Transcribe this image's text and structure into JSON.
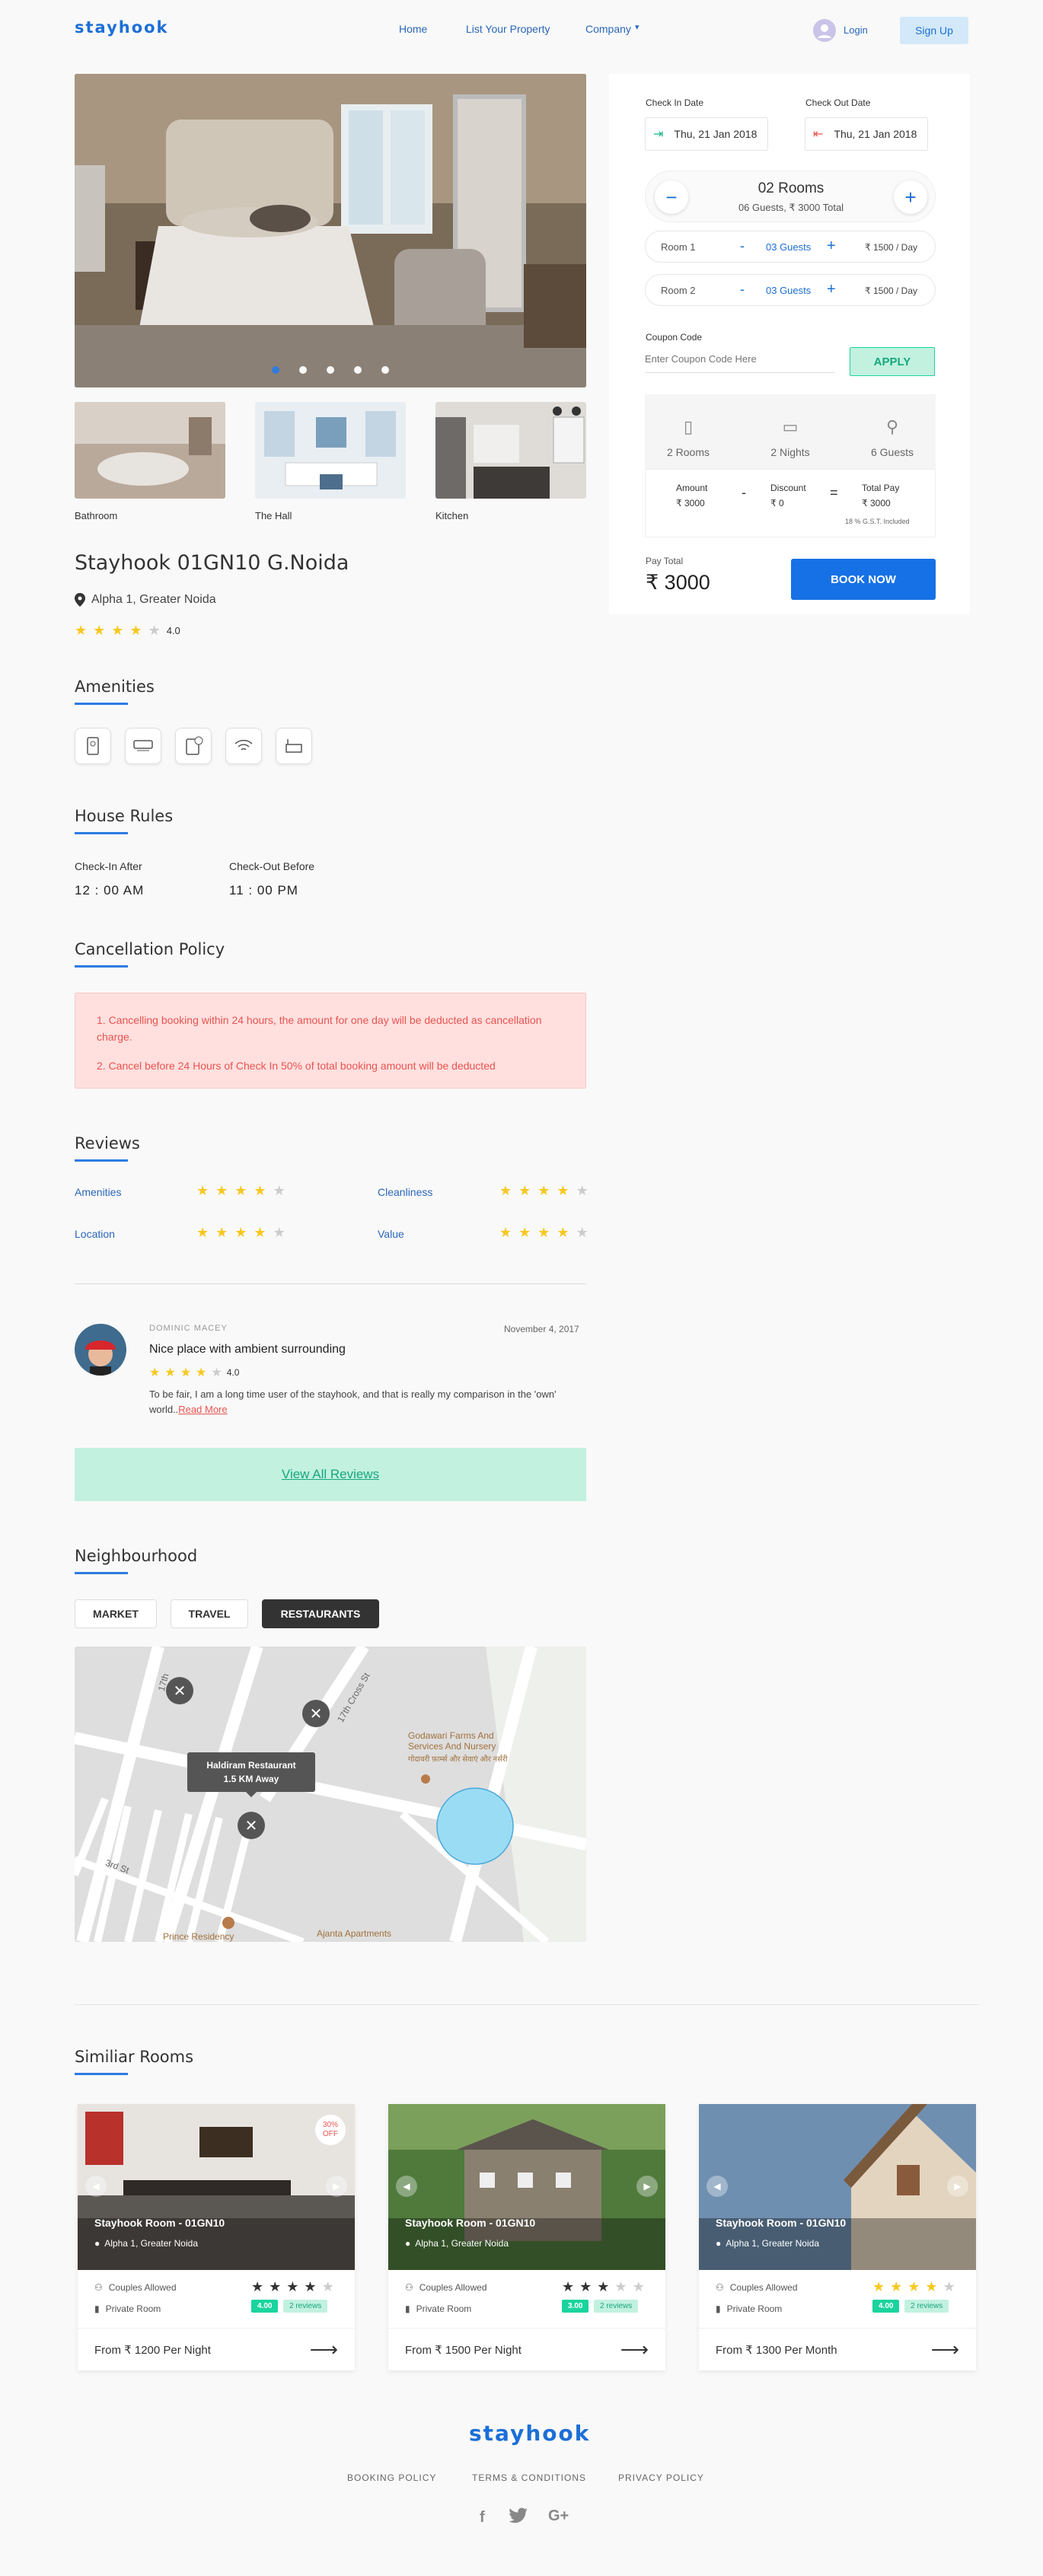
{
  "header": {
    "logo": "stayhook",
    "nav": [
      "Home",
      "List Your Property",
      "Company"
    ],
    "login": "Login",
    "signup": "Sign Up"
  },
  "gallery": {
    "thumbs": [
      "Bathroom",
      "The Hall",
      "Kitchen"
    ],
    "active_slide": 1,
    "slides": 5
  },
  "property": {
    "name": "Stayhook 01GN10 G.Noida",
    "location": "Alpha 1, Greater Noida",
    "rating": "4.0",
    "rating_value": 4
  },
  "amenities": {
    "title": "Amenities",
    "icons": [
      "hotel-door-key-icon",
      "air-conditioner-icon",
      "room-service-icon",
      "wifi-icon",
      "bathtub-icon"
    ]
  },
  "house_rules": {
    "title": "House Rules",
    "checkin_label": "Check-In After",
    "checkin_value": "12 : 00 AM",
    "checkout_label": "Check-Out Before",
    "checkout_value": "11 : 00 PM"
  },
  "cancellation": {
    "title": "Cancellation Policy",
    "items": [
      "1. Cancelling booking within 24 hours, the amount for one day will be deducted as cancellation charge.",
      "2. Cancel before 24 Hours of Check In 50% of total booking amount will be deducted"
    ]
  },
  "reviews": {
    "title": "Reviews",
    "categories": [
      {
        "label": "Amenities",
        "value": 4
      },
      {
        "label": "Cleanliness",
        "value": 4
      },
      {
        "label": "Location",
        "value": 4
      },
      {
        "label": "Value",
        "value": 4
      }
    ],
    "review": {
      "author": "DOMINIC MACEY",
      "date": "November 4, 2017",
      "title": "Nice place with ambient surrounding",
      "rating": "4.0",
      "rating_value": 4,
      "body": "To be fair, I am a long time user of the stayhook, and that is really my comparison in the 'own' world..",
      "read_more": "Read More"
    },
    "view_all": "View All Reviews"
  },
  "neighbourhood": {
    "title": "Neighbourhood",
    "tabs": [
      "MARKET",
      "TRAVEL",
      "RESTAURANTS"
    ],
    "active_tab": "RESTAURANTS",
    "map": {
      "popup_name": "Haldiram Restaurant",
      "popup_distance": "1.5 KM Away",
      "streets": [
        "17th",
        "17th Cross St",
        "3rd St"
      ],
      "places": [
        "Godawari Farms And Services And Nursery",
        "गोदावरी फ़ार्म्स और सेवाएं और नर्सरी",
        "Prince Residency",
        "Ajanta Apartments"
      ]
    }
  },
  "similar": {
    "title": "Similiar Rooms",
    "rooms": [
      {
        "name": "Stayhook Room - 01GN10",
        "location": "Alpha 1, Greater Noida",
        "feature1": "Couples Allowed",
        "feature2": "Private Room",
        "stars": 4,
        "score": "4.00",
        "reviews": "2 reviews",
        "price": "From ₹ 1200 Per Night",
        "offer": "30% OFF",
        "star_color": "#333333"
      },
      {
        "name": "Stayhook Room - 01GN10",
        "location": "Alpha 1, Greater Noida",
        "feature1": "Couples Allowed",
        "feature2": "Private Room",
        "stars": 3,
        "score": "3.00",
        "reviews": "2 reviews",
        "price": "From ₹ 1500 Per Night",
        "offer": "",
        "star_color": "#333333"
      },
      {
        "name": "Stayhook Room - 01GN10",
        "location": "Alpha 1, Greater Noida",
        "feature1": "Couples Allowed",
        "feature2": "Private Room",
        "stars": 4,
        "score": "4.00",
        "reviews": "2 reviews",
        "price": "From ₹ 1300 Per Month",
        "offer": "",
        "star_color": "#f7c820"
      }
    ]
  },
  "footer": {
    "logo": "stayhook",
    "links": [
      "BOOKING POLICY",
      "TERMS & CONDITIONS",
      "PRIVACY POLICY"
    ],
    "social": [
      "facebook-icon",
      "twitter-icon",
      "google-plus-icon"
    ]
  },
  "booking": {
    "checkin_label": "Check In Date",
    "checkin": "Thu, 21 Jan 2018",
    "checkout_label": "Check Out Date",
    "checkout": "Thu, 21 Jan 2018",
    "rooms_count": "02 Rooms",
    "rooms_summary": "06 Guests, ₹ 3000 Total",
    "rooms": [
      {
        "name": "Room 1",
        "guests": "03 Guests",
        "price": "₹ 1500 / Day"
      },
      {
        "name": "Room 2",
        "guests": "03 Guests",
        "price": "₹ 1500 / Day"
      }
    ],
    "coupon_label": "Coupon Code",
    "coupon_placeholder": "Enter Coupon Code Here",
    "apply": "APPLY",
    "summary": {
      "rooms": "2 Rooms",
      "nights": "2 Nights",
      "guests": "6 Guests"
    },
    "amount_label": "Amount",
    "amount": "₹ 3000",
    "discount_label": "Discount",
    "discount": "₹ 0",
    "total_label": "Total Pay",
    "total": "₹ 3000",
    "gst": "18 % G.S.T. Included",
    "pay_total_label": "Pay Total",
    "pay_total": "₹ 3000",
    "book_now": "BOOK NOW"
  },
  "colors": {
    "accent": "#1c6fd6",
    "green": "#19d49e",
    "red": "#e8534f",
    "star": "#f7c820"
  }
}
